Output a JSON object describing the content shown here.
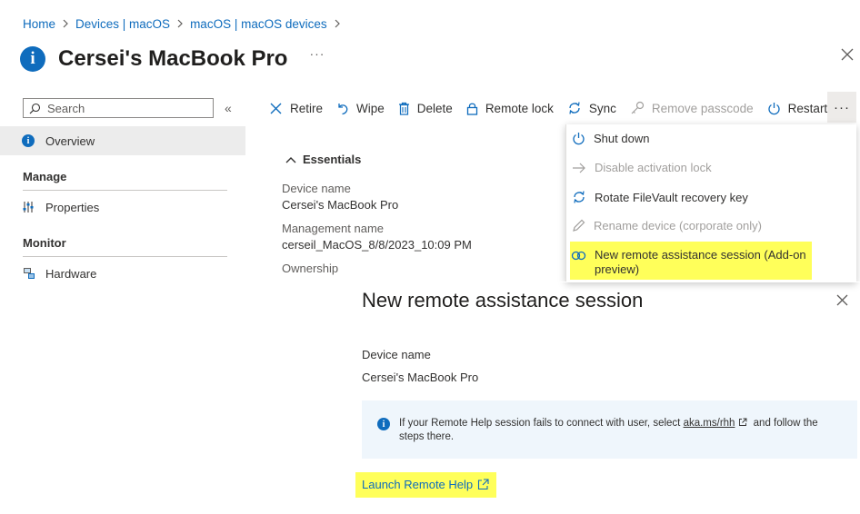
{
  "breadcrumb": {
    "items": [
      "Home",
      "Devices | macOS",
      "macOS | macOS devices"
    ]
  },
  "header": {
    "title": "Cersei's MacBook Pro",
    "more": "···"
  },
  "sidebar": {
    "search_placeholder": "Search",
    "collapse": "«",
    "overview": "Overview",
    "sections": [
      {
        "title": "Manage",
        "items": [
          "Properties"
        ]
      },
      {
        "title": "Monitor",
        "items": [
          "Hardware"
        ]
      }
    ]
  },
  "toolbar": {
    "items": [
      {
        "label": "Retire",
        "icon": "x-icon",
        "disabled": false
      },
      {
        "label": "Wipe",
        "icon": "undo-icon",
        "disabled": false
      },
      {
        "label": "Delete",
        "icon": "trash-icon",
        "disabled": false
      },
      {
        "label": "Remote lock",
        "icon": "lock-icon",
        "disabled": false
      },
      {
        "label": "Sync",
        "icon": "sync-icon",
        "disabled": false
      },
      {
        "label": "Remove passcode",
        "icon": "key-icon",
        "disabled": true
      },
      {
        "label": "Restart",
        "icon": "power-icon",
        "disabled": false
      }
    ],
    "more": "···"
  },
  "essentials": {
    "title": "Essentials",
    "fields": [
      {
        "label": "Device name",
        "value": "Cersei's MacBook Pro"
      },
      {
        "label": "Management name",
        "value": "cerseil_MacOS_8/8/2023_10:09 PM"
      },
      {
        "label": "Ownership",
        "value": ""
      }
    ]
  },
  "dropdown": {
    "items": [
      {
        "label": "Shut down",
        "icon": "power-icon",
        "disabled": false
      },
      {
        "label": "Disable activation lock",
        "icon": "arrow-right-icon",
        "disabled": true
      },
      {
        "label": "Rotate FileVault recovery key",
        "icon": "sync-icon",
        "disabled": false
      },
      {
        "label": "Rename device (corporate only)",
        "icon": "pencil-icon",
        "disabled": true
      },
      {
        "label_line1": "New remote assistance session (Add-on",
        "label_line2": "preview)",
        "icon": "remote-assistance-icon",
        "disabled": false,
        "highlighted": true
      }
    ]
  },
  "remote_pane": {
    "title": "New remote assistance session",
    "device_label": "Device name",
    "device_value": "Cersei's MacBook Pro",
    "info_text_before": "If your Remote Help session fails to connect with user, select ",
    "info_link": "aka.ms/rhh",
    "info_text_after": " and follow the steps there.",
    "launch_label": "Launch Remote Help"
  },
  "colors": {
    "accent": "#0f6cbd",
    "highlight": "#ffff5a",
    "banner": "#eff6fc",
    "selected_nav": "#ececec"
  }
}
